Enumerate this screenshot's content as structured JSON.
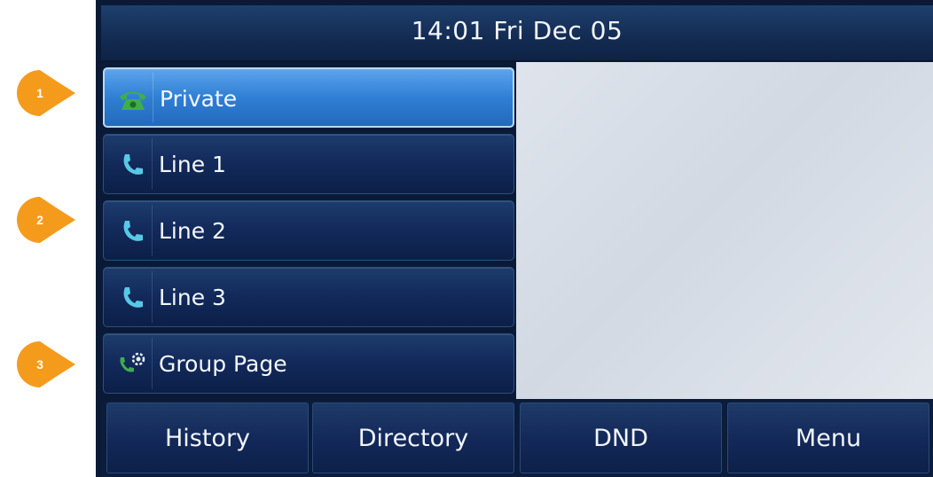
{
  "status_bar": {
    "clock": "14:01 Fri Dec 05"
  },
  "line_keys": [
    {
      "label": "Private",
      "icon": "registered-line-icon",
      "active": true
    },
    {
      "label": "Line 1",
      "icon": "handset-icon",
      "active": false
    },
    {
      "label": "Line 2",
      "icon": "handset-icon",
      "active": false
    },
    {
      "label": "Line 3",
      "icon": "handset-icon",
      "active": false
    },
    {
      "label": "Group Page",
      "icon": "paging-icon",
      "active": false
    }
  ],
  "softkeys": [
    "History",
    "Directory",
    "DND",
    "Menu"
  ],
  "callouts": [
    "1",
    "2",
    "3"
  ],
  "colors": {
    "callout": "#f59b1c",
    "active_key": "#2f7fd4",
    "key": "#12295a",
    "icon_green": "#3fae4a",
    "icon_cyan": "#59c7e6"
  }
}
